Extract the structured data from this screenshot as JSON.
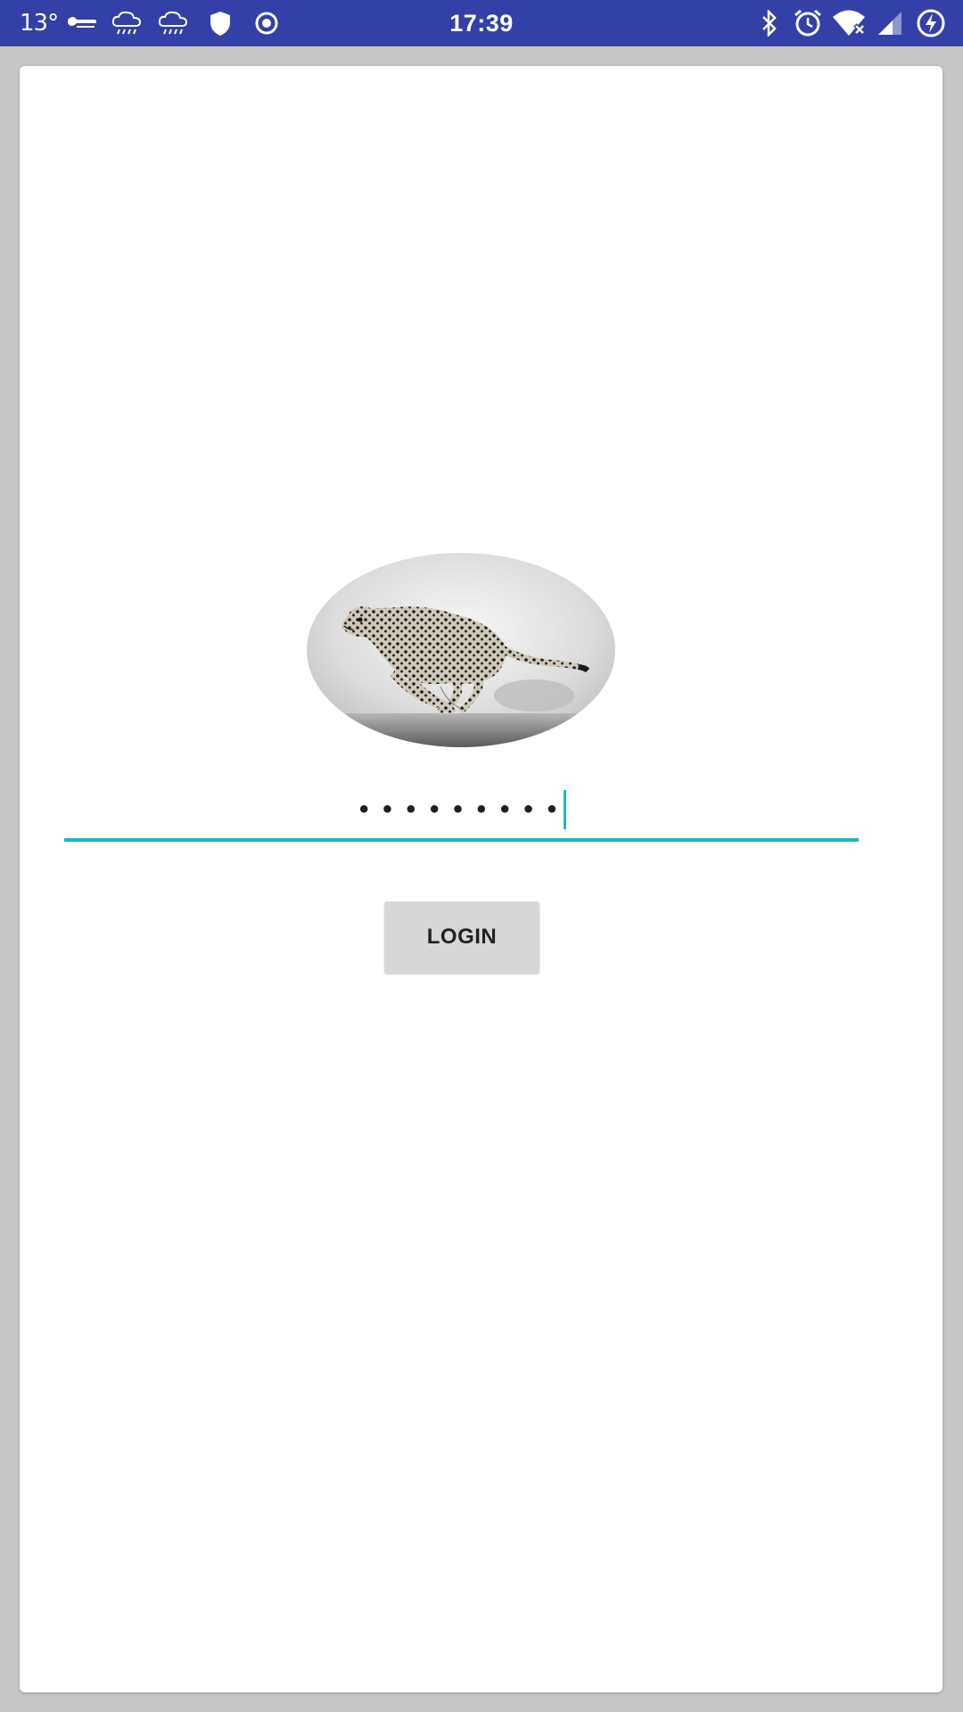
{
  "status_bar": {
    "temperature": "13°",
    "time": "17:39",
    "background_color": "#3240a8",
    "left_icons": [
      "drone-icon",
      "rain-cloud-icon",
      "rain-cloud-icon",
      "shield-icon",
      "radio-button-icon"
    ],
    "right_icons": [
      "bluetooth-icon",
      "alarm-clock-icon",
      "wifi-no-internet-icon",
      "cell-signal-icon",
      "battery-charging-icon"
    ]
  },
  "main": {
    "logo_alt": "cheetah",
    "password": {
      "value": "•••••••••",
      "underline_color": "#1eb5c8"
    },
    "login_button": {
      "label": "LOGIN"
    }
  }
}
